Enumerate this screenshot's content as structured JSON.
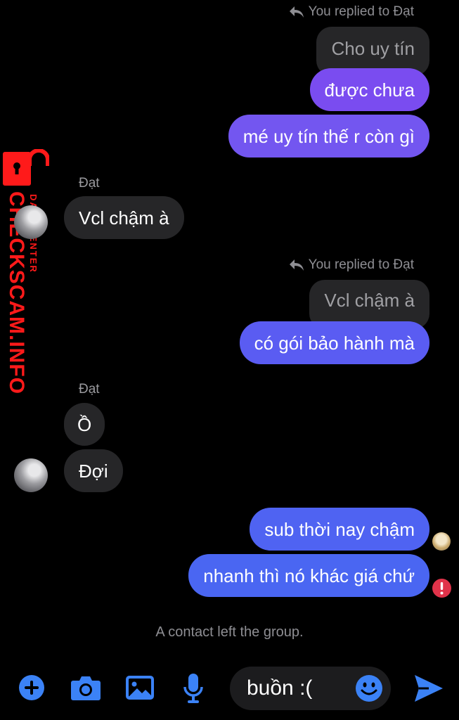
{
  "colors": {
    "background": "#000000",
    "incoming_bubble": "#262628",
    "outgoing_purple": "#7b4ef0",
    "outgoing_blue": "#5360f2",
    "accent_blue": "#3b82f6",
    "error_red": "#e0334a",
    "watermark_red": "#ff1a1a"
  },
  "messages": {
    "reply_note_1": "You replied to Đạt",
    "quoted_1": "Cho uy tín",
    "out_1": "được chưa",
    "out_2": "mé uy tín thế r còn gì",
    "sender_1": "Đạt",
    "in_1": "Vcl chậm à",
    "reply_note_2": "You replied to Đạt",
    "quoted_2": "Vcl chậm à",
    "out_3": "có gói bảo hành mà",
    "sender_2": "Đạt",
    "in_2": "Ồ",
    "in_3": "Đợi",
    "out_4": "sub thời nay chậm",
    "out_5": "nhanh thì nó khác giá chứ"
  },
  "system_message": "A contact left the group.",
  "watermark": {
    "main": "CHECKSCAM.INFO",
    "sub": "DATA CENTER"
  },
  "composer": {
    "value": "buồn :("
  },
  "icons": {
    "reply": "reply-arrow-icon",
    "add": "plus-circle-icon",
    "camera": "camera-icon",
    "gallery": "image-icon",
    "mic": "microphone-icon",
    "emoji": "smiley-icon",
    "send": "send-icon",
    "error": "error-icon"
  }
}
